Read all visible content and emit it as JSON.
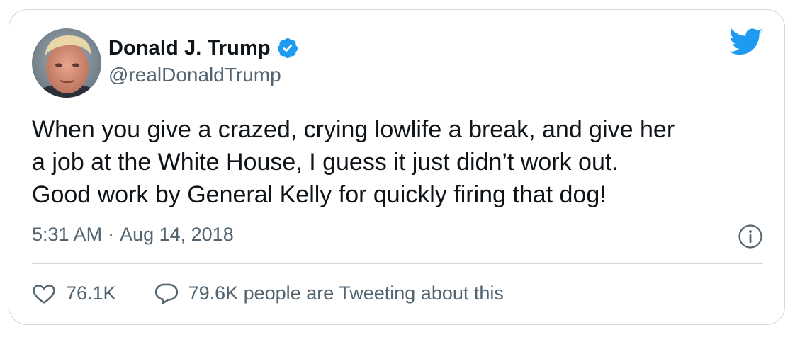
{
  "author": {
    "display_name": "Donald J. Trump",
    "handle": "@realDonaldTrump",
    "verified": true
  },
  "tweet": {
    "lines": [
      "When you give a crazed, crying lowlife a break, and give her",
      "a job at the White House, I guess it just didn’t work out.",
      "Good work by General Kelly for quickly firing that dog!"
    ],
    "time": "5:31 AM",
    "separator": "·",
    "date": "Aug 14, 2018"
  },
  "actions": {
    "like_count": "76.1K",
    "reply_label": "79.6K people are Tweeting about this"
  },
  "colors": {
    "brand": "#1d9bf0",
    "text_primary": "#0f1419",
    "text_secondary": "#536471",
    "border": "#cfd9de"
  },
  "icons": {
    "brand": "twitter-bird-icon",
    "verified": "verified-badge-icon",
    "info": "info-icon",
    "like": "heart-icon",
    "reply": "speech-bubble-icon"
  }
}
